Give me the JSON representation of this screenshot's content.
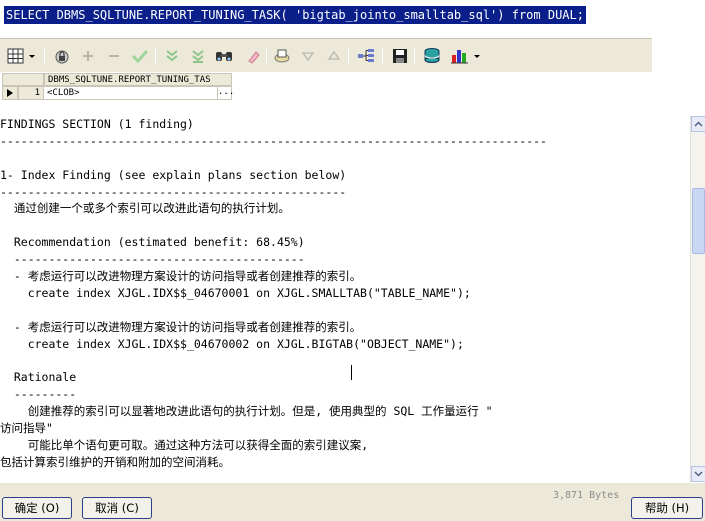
{
  "sql_editor": {
    "statement": "SELECT DBMS_SQLTUNE.REPORT_TUNING_TASK( 'bigtab_jointo_smalltab_sql') from DUAL;"
  },
  "toolbar": {
    "icons": [
      "grid-menu-icon",
      "lock-icon",
      "add-icon",
      "remove-icon",
      "check-icon",
      "first-record-icon",
      "last-record-icon",
      "find-icon",
      "clear-icon",
      "export-icon",
      "prior-icon",
      "next-icon",
      "tree-icon",
      "save-icon",
      "database-icon",
      "chart-menu-icon"
    ]
  },
  "results_grid": {
    "column_header": "DBMS_SQLTUNE.REPORT_TUNING_TAS",
    "rows": [
      {
        "row_number": "1",
        "value": "<CLOB>",
        "ellipsis": "..."
      }
    ]
  },
  "report_lines": [
    "FINDINGS SECTION (1 finding)",
    "-------------------------------------------------------------------------------",
    "",
    "1- Index Finding (see explain plans section below)",
    "--------------------------------------------------",
    "  通过创建一个或多个索引可以改进此语句的执行计划。",
    "",
    "  Recommendation (estimated benefit: 68.45%)",
    "  ------------------------------------------",
    "  - 考虑运行可以改进物理方案设计的访问指导或者创建推荐的索引。",
    "    create index XJGL.IDX$$_04670001 on XJGL.SMALLTAB(\"TABLE_NAME\");",
    "",
    "  - 考虑运行可以改进物理方案设计的访问指导或者创建推荐的索引。",
    "    create index XJGL.IDX$$_04670002 on XJGL.BIGTAB(\"OBJECT_NAME\");",
    "",
    "  Rationale",
    "  ---------",
    "    创建推荐的索引可以显著地改进此语句的执行计划。但是, 使用典型的 SQL 工作量运行 \"",
    "访问指导\"",
    "    可能比单个语句更可取。通过这种方法可以获得全面的索引建议案,",
    "包括计算索引维护的开销和附加的空间消耗。"
  ],
  "footer": {
    "ok_button": "确定 (O)",
    "cancel_button": "取消 (C)",
    "byte_count": "3,871 Bytes",
    "help_button": "帮助 (H)"
  },
  "colors": {
    "selection": "#0a1f8a",
    "dialog_face": "#ece9d8",
    "button_border": "#2d3f8c"
  }
}
